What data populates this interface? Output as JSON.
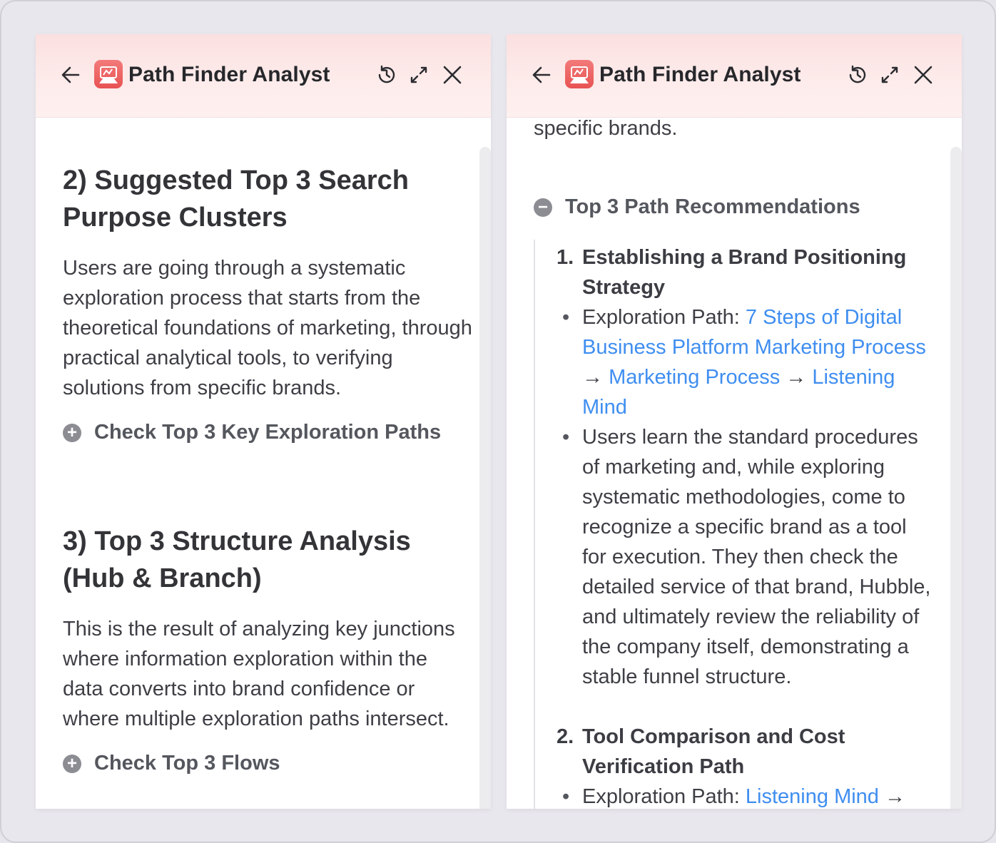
{
  "app": {
    "title": "Path Finder Analyst"
  },
  "left_panel": {
    "section2": {
      "heading": "2) Suggested Top 3 Search Purpose Clusters",
      "body": "Users are going through a systematic exploration process that starts from the theoretical foundations of marketing, through practical analytical tools, to verifying solutions from specific brands.",
      "toggle_label": "Check Top 3 Key Exploration Paths",
      "toggle_icon": "plus-circle-icon"
    },
    "section3": {
      "heading": "3) Top 3 Structure Analysis (Hub & Branch)",
      "body": "This is the result of analyzing key junctions where information exploration within the data converts into brand confidence or where multiple exploration paths intersect.",
      "toggle_label": "Check Top 3 Flows",
      "toggle_icon": "plus-circle-icon"
    }
  },
  "right_panel": {
    "top_fragment": "specific brands.",
    "toggle_label": "Top 3 Path Recommendations",
    "toggle_icon": "minus-circle-icon",
    "items": [
      {
        "number": "1.",
        "title": "Establishing a Brand Positioning Strategy",
        "path_prefix": "Exploration Path: ",
        "path_links": [
          "7 Steps of Digital Business Platform Marketing Process",
          "Marketing Process",
          "Listening Mind"
        ],
        "arrow": "→",
        "description": "Users learn the standard procedures of marketing and, while exploring systematic methodologies, come to recognize a specific brand as a tool for execution. They then check the detailed service of that brand, Hubble, and ultimately review the reliability of the company itself, demonstrating a stable funnel structure."
      },
      {
        "number": "2.",
        "title": "Tool Comparison and Cost Verification Path",
        "path_prefix": "Exploration Path: ",
        "path_links": [
          "Listening Mind"
        ],
        "arrow": "→"
      }
    ]
  },
  "colors": {
    "header_gradient": "#fbe0e0",
    "logo": "#e85353",
    "link": "#3f8ef0",
    "text": "#3d3f45",
    "background": "#e7e6ec"
  }
}
